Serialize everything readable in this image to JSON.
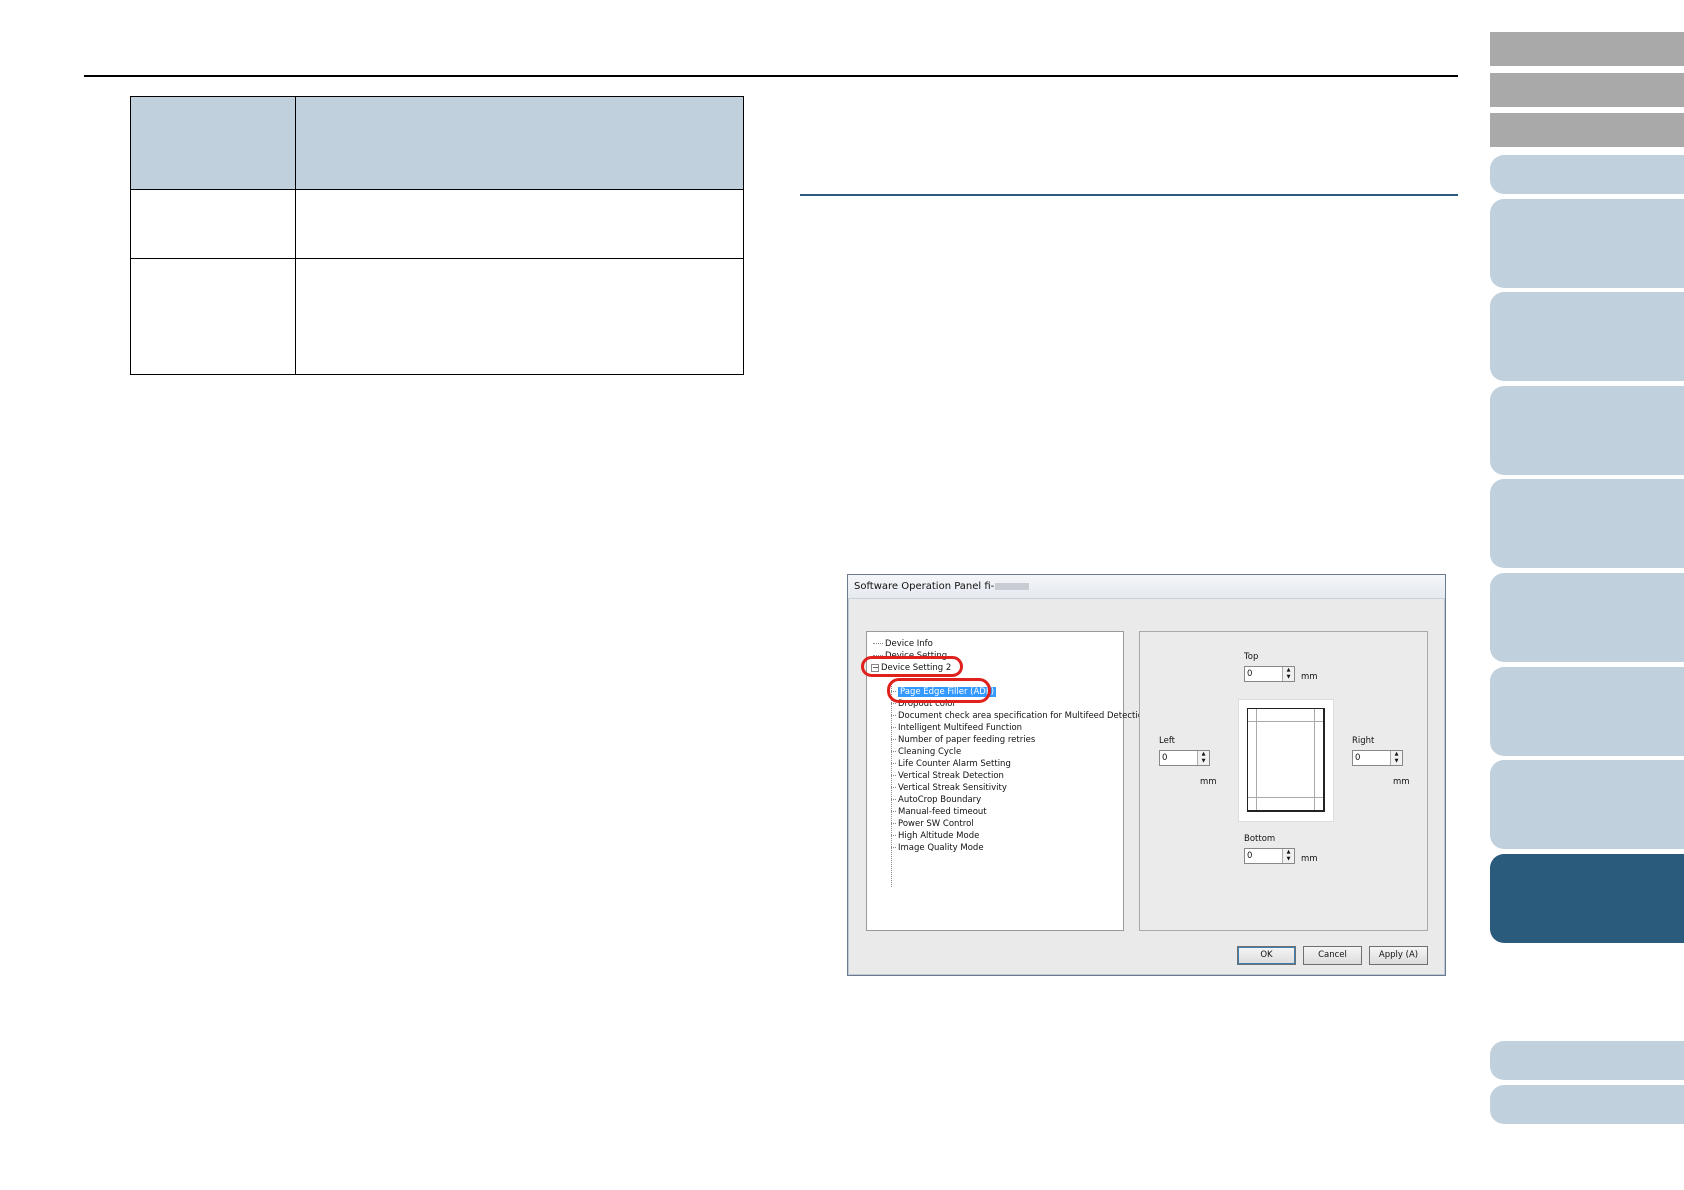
{
  "dialog": {
    "title": "Software Operation Panel fi-",
    "tree": {
      "items": [
        {
          "label": "Device Info"
        },
        {
          "label": "Device Setting"
        },
        {
          "label": "Device Setting 2"
        },
        {
          "label": "Page Edge Filler (ADF)"
        },
        {
          "label": "Dropout color"
        },
        {
          "label": "Document check area specification for Multifeed Detection"
        },
        {
          "label": "Intelligent Multifeed Function"
        },
        {
          "label": "Number of paper feeding retries"
        },
        {
          "label": "Cleaning Cycle"
        },
        {
          "label": "Life Counter Alarm Setting"
        },
        {
          "label": "Vertical Streak Detection"
        },
        {
          "label": "Vertical Streak Sensitivity"
        },
        {
          "label": "AutoCrop Boundary"
        },
        {
          "label": "Manual-feed timeout"
        },
        {
          "label": "Power SW Control"
        },
        {
          "label": "High Altitude Mode"
        },
        {
          "label": "Image Quality Mode"
        }
      ],
      "expander_symbol": "−"
    },
    "settings": {
      "top": {
        "label": "Top",
        "value": "0",
        "unit": "mm"
      },
      "left": {
        "label": "Left",
        "value": "0",
        "unit": "mm"
      },
      "right": {
        "label": "Right",
        "value": "0",
        "unit": "mm"
      },
      "bottom": {
        "label": "Bottom",
        "value": "0",
        "unit": "mm"
      }
    },
    "buttons": {
      "ok": "OK",
      "cancel": "Cancel",
      "apply": "Apply (A)"
    }
  },
  "colors": {
    "header_fill": "#c0d0dc",
    "nav_dark": "#2a5a7c",
    "nav_gray": "#a9a9a9",
    "highlight_circle": "#e0201c",
    "selection": "#3399ff"
  }
}
